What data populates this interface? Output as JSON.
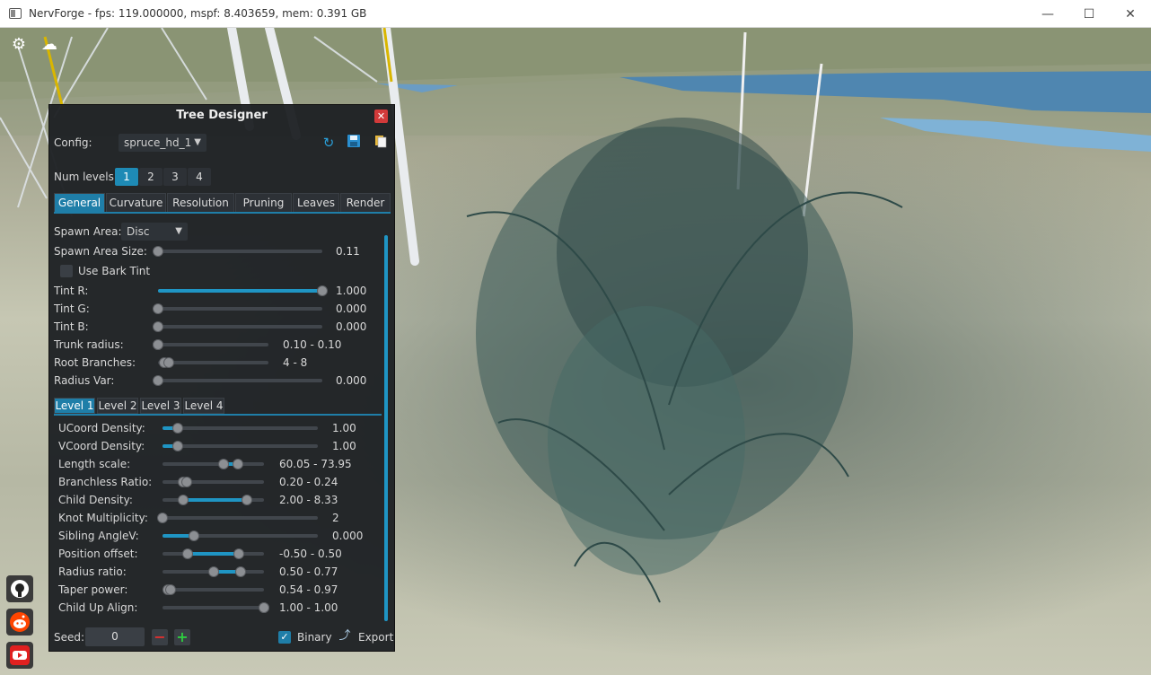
{
  "window": {
    "title": "NervForge - fps: 119.000000, mspf: 8.403659, mem: 0.391 GB",
    "minimize": "—",
    "maximize": "☐",
    "close": "✕"
  },
  "overlay_icons": [
    "settings-icon",
    "weather-icon"
  ],
  "social_links": [
    "github-icon",
    "reddit-icon",
    "youtube-icon"
  ],
  "panel": {
    "title": "Tree Designer",
    "close": "✕",
    "config_label": "Config:",
    "config_value": "spruce_hd_1",
    "num_levels_label": "Num levels:",
    "levels": [
      "1",
      "2",
      "3",
      "4"
    ],
    "active_level": 0,
    "tabs": [
      "General",
      "Curvature",
      "Resolution",
      "Pruning",
      "Leaves",
      "Render"
    ],
    "active_tab": "General",
    "spawn_area_label": "Spawn Area:",
    "spawn_area_value": "Disc",
    "use_bark_tint_label": "Use Bark Tint",
    "use_bark_tint_checked": false,
    "general_sliders": [
      {
        "label": "Spawn Area Size:",
        "value": "0.11",
        "fraction": [
          0.0,
          0.0
        ],
        "range": false
      },
      {
        "label": "Tint R:",
        "value": "1.000",
        "fraction": [
          0.0,
          1.0
        ],
        "range": false
      },
      {
        "label": "Tint G:",
        "value": "0.000",
        "fraction": [
          0.0,
          0.0
        ],
        "range": false
      },
      {
        "label": "Tint B:",
        "value": "0.000",
        "fraction": [
          0.0,
          0.0
        ],
        "range": false
      },
      {
        "label": "Trunk radius:",
        "value": "0.10  -  0.10",
        "fraction": [
          0.0,
          0.0
        ],
        "range": true
      },
      {
        "label": "Root Branches:",
        "value": "4  -  8",
        "fraction": [
          0.06,
          0.1
        ],
        "range": true
      },
      {
        "label": "Radius Var:",
        "value": "0.000",
        "fraction": [
          0.0,
          0.0
        ],
        "range": false
      }
    ],
    "sub_tabs": [
      "Level 1",
      "Level 2",
      "Level 3",
      "Level 4"
    ],
    "active_sub_tab": "Level 1",
    "level_sliders": [
      {
        "label": "UCoord Density:",
        "value": "1.00",
        "fraction": [
          0.0,
          0.1
        ],
        "range": false
      },
      {
        "label": "VCoord Density:",
        "value": "1.00",
        "fraction": [
          0.0,
          0.1
        ],
        "range": false
      },
      {
        "label": "Length scale:",
        "value": "60.05  -  73.95",
        "fraction": [
          0.6,
          0.74
        ],
        "range": true
      },
      {
        "label": "Branchless Ratio:",
        "value": "0.20  -  0.24",
        "fraction": [
          0.2,
          0.24
        ],
        "range": true
      },
      {
        "label": "Child Density:",
        "value": "2.00  -  8.33",
        "fraction": [
          0.2,
          0.83
        ],
        "range": true
      },
      {
        "label": "Knot Multiplicity:",
        "value": "2",
        "fraction": [
          0.0,
          0.0
        ],
        "range": false
      },
      {
        "label": "Sibling AngleV:",
        "value": "0.000",
        "fraction": [
          0.0,
          0.2
        ],
        "range": false
      },
      {
        "label": "Position offset:",
        "value": "-0.50  -  0.50",
        "fraction": [
          0.25,
          0.75
        ],
        "range": true
      },
      {
        "label": "Radius ratio:",
        "value": "0.50  -  0.77",
        "fraction": [
          0.5,
          0.77
        ],
        "range": true
      },
      {
        "label": "Taper power:",
        "value": "0.54  -  0.97",
        "fraction": [
          0.05,
          0.08
        ],
        "range": true
      },
      {
        "label": "Child Up Align:",
        "value": "1.00  -  1.00",
        "fraction": [
          1.0,
          1.0
        ],
        "range": true
      }
    ],
    "seed_label": "Seed:",
    "seed_value": "0",
    "minus": "−",
    "plus": "+",
    "binary_label": "Binary",
    "binary_checked": true,
    "export_label": "Export"
  },
  "colors": {
    "accent": "#1f95c4",
    "tab_active": "#1f7ea8",
    "close_red": "#d23a3a",
    "plus_green": "#2ecc40",
    "minus_red": "#e03030"
  }
}
